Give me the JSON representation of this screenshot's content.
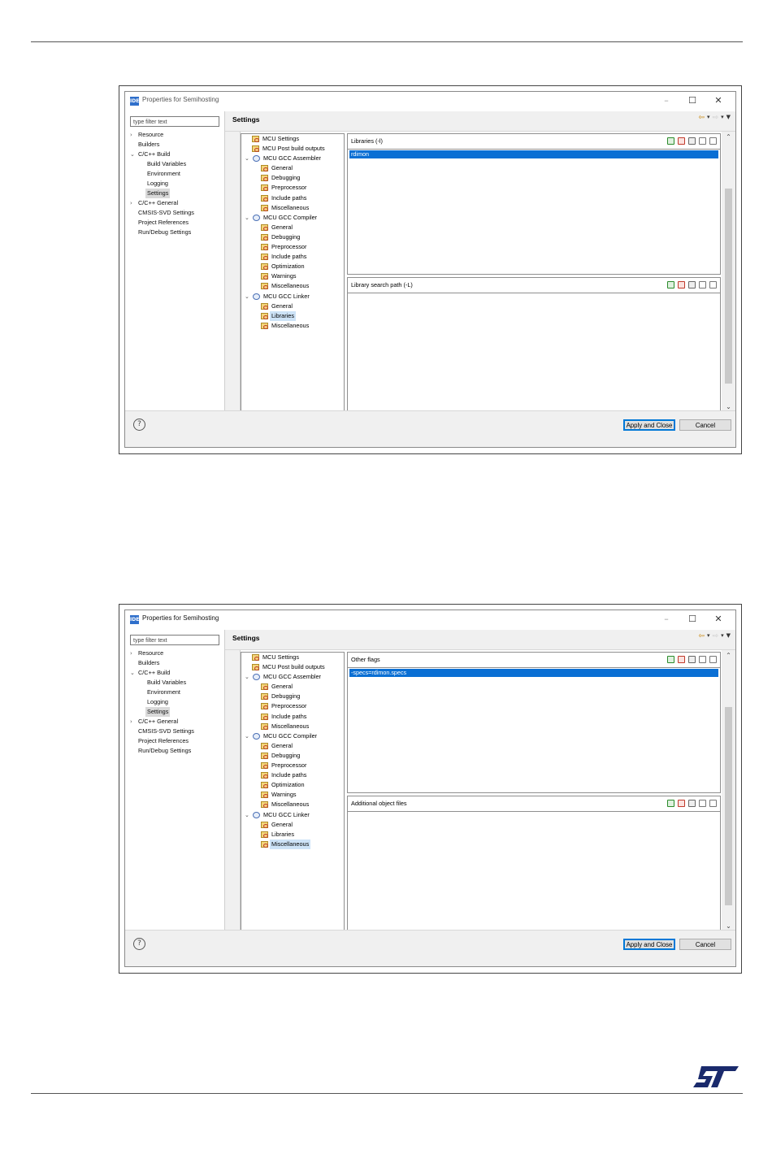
{
  "page": {
    "logo_text": "ST"
  },
  "figures": [
    {
      "dialog_title": "Properties for Semihosting",
      "filter_placeholder": "type filter text",
      "nav": [
        {
          "label": "Resource",
          "indent": 1,
          "chevron": "›"
        },
        {
          "label": "Builders",
          "indent": 1,
          "chevron": ""
        },
        {
          "label": "C/C++ Build",
          "indent": 1,
          "chevron": "⌄"
        },
        {
          "label": "Build Variables",
          "indent": 2,
          "chevron": ""
        },
        {
          "label": "Environment",
          "indent": 2,
          "chevron": ""
        },
        {
          "label": "Logging",
          "indent": 2,
          "chevron": ""
        },
        {
          "label": "Settings",
          "indent": 2,
          "chevron": "",
          "selected": true
        },
        {
          "label": "C/C++ General",
          "indent": 1,
          "chevron": "›"
        },
        {
          "label": "CMSIS-SVD Settings",
          "indent": 1,
          "chevron": ""
        },
        {
          "label": "Project References",
          "indent": 1,
          "chevron": ""
        },
        {
          "label": "Run/Debug Settings",
          "indent": 1,
          "chevron": ""
        }
      ],
      "settings_title": "Settings",
      "tool_tree": [
        {
          "label": "MCU Settings",
          "level": 1,
          "icon": "folder",
          "chevron": ""
        },
        {
          "label": "MCU Post build outputs",
          "level": 1,
          "icon": "folder",
          "chevron": ""
        },
        {
          "label": "MCU GCC Assembler",
          "level": 0,
          "icon": "gear",
          "chevron": "⌄"
        },
        {
          "label": "General",
          "level": 2,
          "icon": "folder",
          "chevron": ""
        },
        {
          "label": "Debugging",
          "level": 2,
          "icon": "folder",
          "chevron": ""
        },
        {
          "label": "Preprocessor",
          "level": 2,
          "icon": "folder",
          "chevron": ""
        },
        {
          "label": "Include paths",
          "level": 2,
          "icon": "folder",
          "chevron": ""
        },
        {
          "label": "Miscellaneous",
          "level": 2,
          "icon": "folder",
          "chevron": ""
        },
        {
          "label": "MCU GCC Compiler",
          "level": 0,
          "icon": "gear",
          "chevron": "⌄"
        },
        {
          "label": "General",
          "level": 2,
          "icon": "folder",
          "chevron": ""
        },
        {
          "label": "Debugging",
          "level": 2,
          "icon": "folder",
          "chevron": ""
        },
        {
          "label": "Preprocessor",
          "level": 2,
          "icon": "folder",
          "chevron": ""
        },
        {
          "label": "Include paths",
          "level": 2,
          "icon": "folder",
          "chevron": ""
        },
        {
          "label": "Optimization",
          "level": 2,
          "icon": "folder",
          "chevron": ""
        },
        {
          "label": "Warnings",
          "level": 2,
          "icon": "folder",
          "chevron": ""
        },
        {
          "label": "Miscellaneous",
          "level": 2,
          "icon": "folder",
          "chevron": ""
        },
        {
          "label": "MCU GCC Linker",
          "level": 0,
          "icon": "gear",
          "chevron": "⌄"
        },
        {
          "label": "General",
          "level": 2,
          "icon": "folder",
          "chevron": ""
        },
        {
          "label": "Libraries",
          "level": 2,
          "icon": "folder",
          "chevron": "",
          "selected": true
        },
        {
          "label": "Miscellaneous",
          "level": 2,
          "icon": "folder",
          "chevron": ""
        }
      ],
      "panel_top": {
        "label": "Libraries (-l)",
        "entries": [
          "rdimon"
        ]
      },
      "panel_bottom": {
        "label": "Library search path (-L)",
        "entries": []
      },
      "apply_label": "Apply and Close",
      "cancel_label": "Cancel"
    },
    {
      "dialog_title": "Properties for Semihosting",
      "filter_placeholder": "type filter text",
      "nav": [
        {
          "label": "Resource",
          "indent": 1,
          "chevron": "›"
        },
        {
          "label": "Builders",
          "indent": 1,
          "chevron": ""
        },
        {
          "label": "C/C++ Build",
          "indent": 1,
          "chevron": "⌄"
        },
        {
          "label": "Build Variables",
          "indent": 2,
          "chevron": ""
        },
        {
          "label": "Environment",
          "indent": 2,
          "chevron": ""
        },
        {
          "label": "Logging",
          "indent": 2,
          "chevron": ""
        },
        {
          "label": "Settings",
          "indent": 2,
          "chevron": "",
          "selected": true
        },
        {
          "label": "C/C++ General",
          "indent": 1,
          "chevron": "›"
        },
        {
          "label": "CMSIS-SVD Settings",
          "indent": 1,
          "chevron": ""
        },
        {
          "label": "Project References",
          "indent": 1,
          "chevron": ""
        },
        {
          "label": "Run/Debug Settings",
          "indent": 1,
          "chevron": ""
        }
      ],
      "settings_title": "Settings",
      "tool_tree": [
        {
          "label": "MCU Settings",
          "level": 1,
          "icon": "folder",
          "chevron": ""
        },
        {
          "label": "MCU Post build outputs",
          "level": 1,
          "icon": "folder",
          "chevron": ""
        },
        {
          "label": "MCU GCC Assembler",
          "level": 0,
          "icon": "gear",
          "chevron": "⌄"
        },
        {
          "label": "General",
          "level": 2,
          "icon": "folder",
          "chevron": ""
        },
        {
          "label": "Debugging",
          "level": 2,
          "icon": "folder",
          "chevron": ""
        },
        {
          "label": "Preprocessor",
          "level": 2,
          "icon": "folder",
          "chevron": ""
        },
        {
          "label": "Include paths",
          "level": 2,
          "icon": "folder",
          "chevron": ""
        },
        {
          "label": "Miscellaneous",
          "level": 2,
          "icon": "folder",
          "chevron": ""
        },
        {
          "label": "MCU GCC Compiler",
          "level": 0,
          "icon": "gear",
          "chevron": "⌄"
        },
        {
          "label": "General",
          "level": 2,
          "icon": "folder",
          "chevron": ""
        },
        {
          "label": "Debugging",
          "level": 2,
          "icon": "folder",
          "chevron": ""
        },
        {
          "label": "Preprocessor",
          "level": 2,
          "icon": "folder",
          "chevron": ""
        },
        {
          "label": "Include paths",
          "level": 2,
          "icon": "folder",
          "chevron": ""
        },
        {
          "label": "Optimization",
          "level": 2,
          "icon": "folder",
          "chevron": ""
        },
        {
          "label": "Warnings",
          "level": 2,
          "icon": "folder",
          "chevron": ""
        },
        {
          "label": "Miscellaneous",
          "level": 2,
          "icon": "folder",
          "chevron": ""
        },
        {
          "label": "MCU GCC Linker",
          "level": 0,
          "icon": "gear",
          "chevron": "⌄"
        },
        {
          "label": "General",
          "level": 2,
          "icon": "folder",
          "chevron": ""
        },
        {
          "label": "Libraries",
          "level": 2,
          "icon": "folder",
          "chevron": ""
        },
        {
          "label": "Miscellaneous",
          "level": 2,
          "icon": "folder",
          "chevron": "",
          "selected": true
        }
      ],
      "panel_top": {
        "label": "Other flags",
        "entries": [
          "-specs=rdimon.specs"
        ]
      },
      "panel_bottom": {
        "label": "Additional object files",
        "entries": []
      },
      "apply_label": "Apply and Close",
      "cancel_label": "Cancel"
    }
  ]
}
